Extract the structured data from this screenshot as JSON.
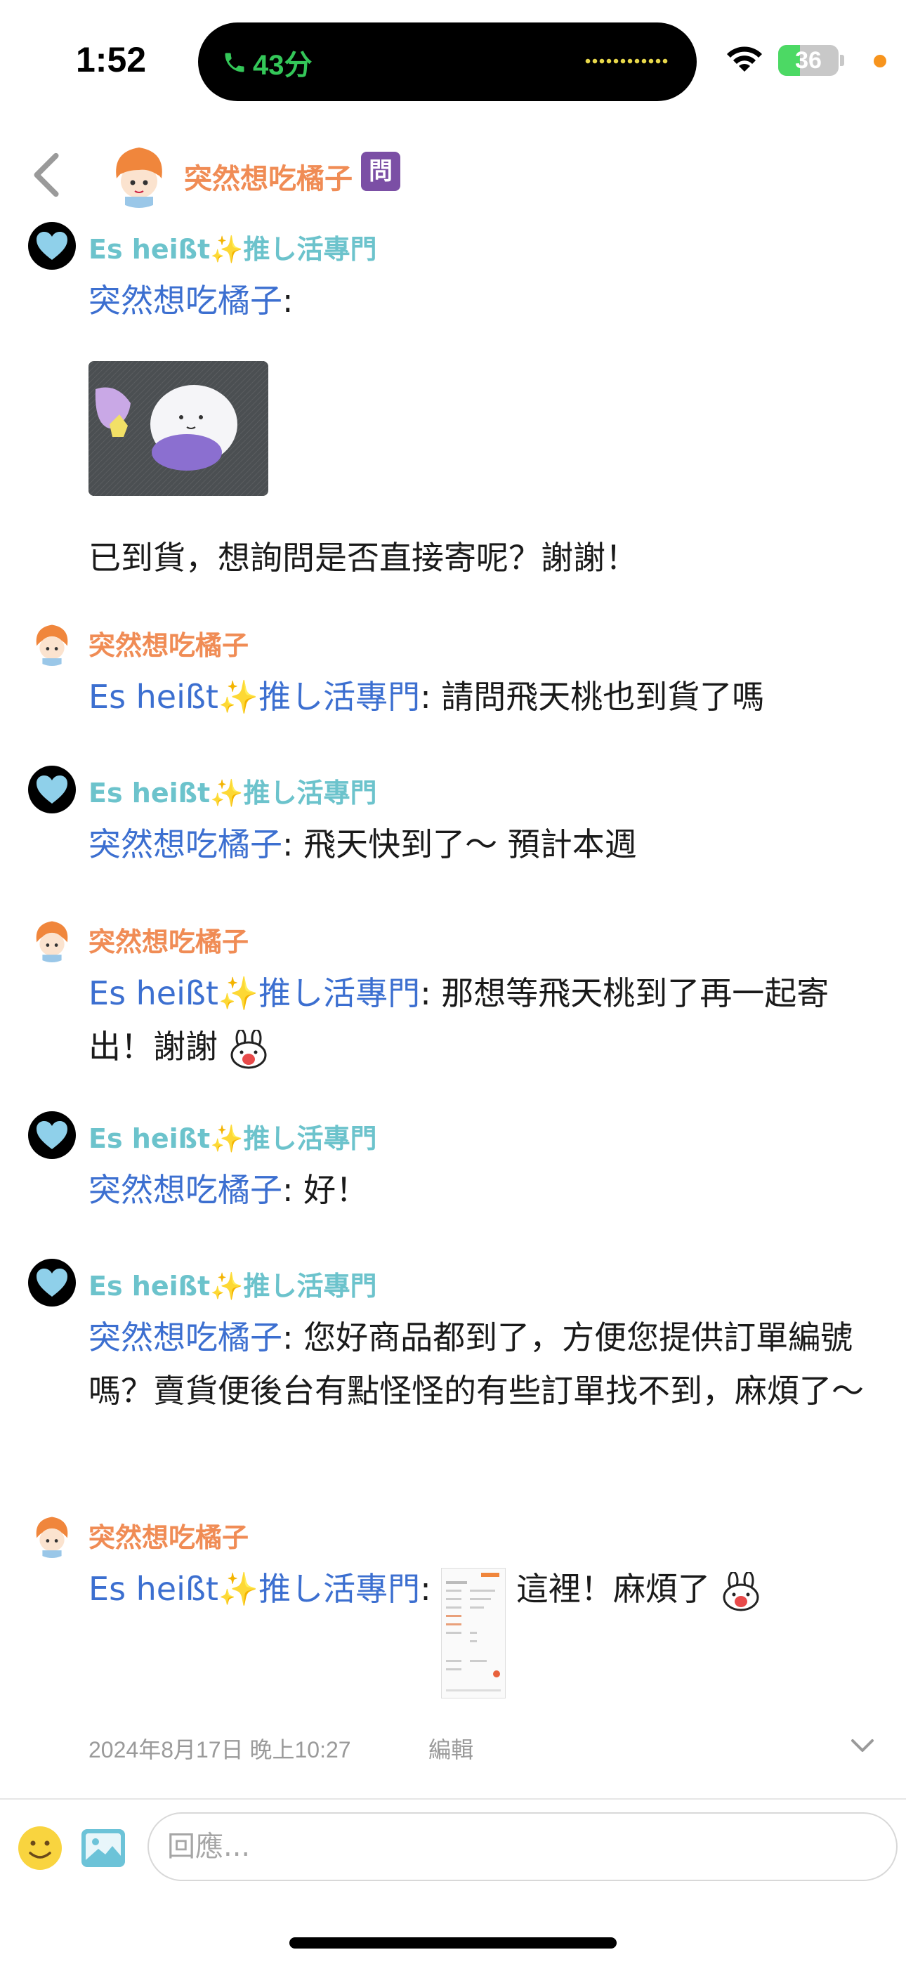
{
  "status_bar": {
    "time": "1:52",
    "call_duration": "43分",
    "battery_level": "36",
    "battery_fraction": 0.36
  },
  "header": {
    "title": "突然想吃橘子",
    "badge": "問"
  },
  "messages": [
    {
      "sender": "Es heißt✨推し活專門",
      "mention": "突然想吃橘子",
      "separator": ":",
      "text": "已到貨，想詢問是否直接寄呢？謝謝！"
    },
    {
      "sender": "突然想吃橘子",
      "mention": "Es heißt✨推し活專門",
      "separator": ":",
      "text": " 請問飛天桃也到貨了嗎"
    },
    {
      "sender": "Es heißt✨推し活專門",
      "mention": "突然想吃橘子",
      "separator": ":",
      "text": " 飛天快到了～ 預計本週"
    },
    {
      "sender": "突然想吃橘子",
      "mention": "Es heißt✨推し活專門",
      "separator": ":",
      "text": " 那想等飛天桃到了再一起寄出！謝謝"
    },
    {
      "sender": "Es heißt✨推し活專門",
      "mention": "突然想吃橘子",
      "separator": ":",
      "text": " 好！"
    },
    {
      "sender": "Es heißt✨推し活專門",
      "mention": "突然想吃橘子",
      "separator": ":",
      "text": " 您好商品都到了，方便您提供訂單編號嗎？賣貨便後台有點怪怪的有些訂單找不到，麻煩了～"
    },
    {
      "sender": "突然想吃橘子",
      "mention": "Es heißt✨推し活專門",
      "separator": ":",
      "text": " 這裡！麻煩了"
    }
  ],
  "meta": {
    "timestamp": "2024年8月17日 晚上10:27",
    "edit_label": "編輯"
  },
  "composer": {
    "placeholder": "回應..."
  },
  "colors": {
    "mention": "#3c6fd0",
    "sender_es": "#6cc3cc",
    "sender_tz": "#f08c55",
    "badge": "#7b4fa5",
    "call_green": "#34c759"
  },
  "icons": [
    "back-chevron-icon",
    "phone-icon",
    "wifi-icon",
    "smiley-icon",
    "image-icon",
    "chevron-down-icon",
    "bunny-emoji-icon",
    "sparkle-icon",
    "heart-avatar-icon"
  ]
}
